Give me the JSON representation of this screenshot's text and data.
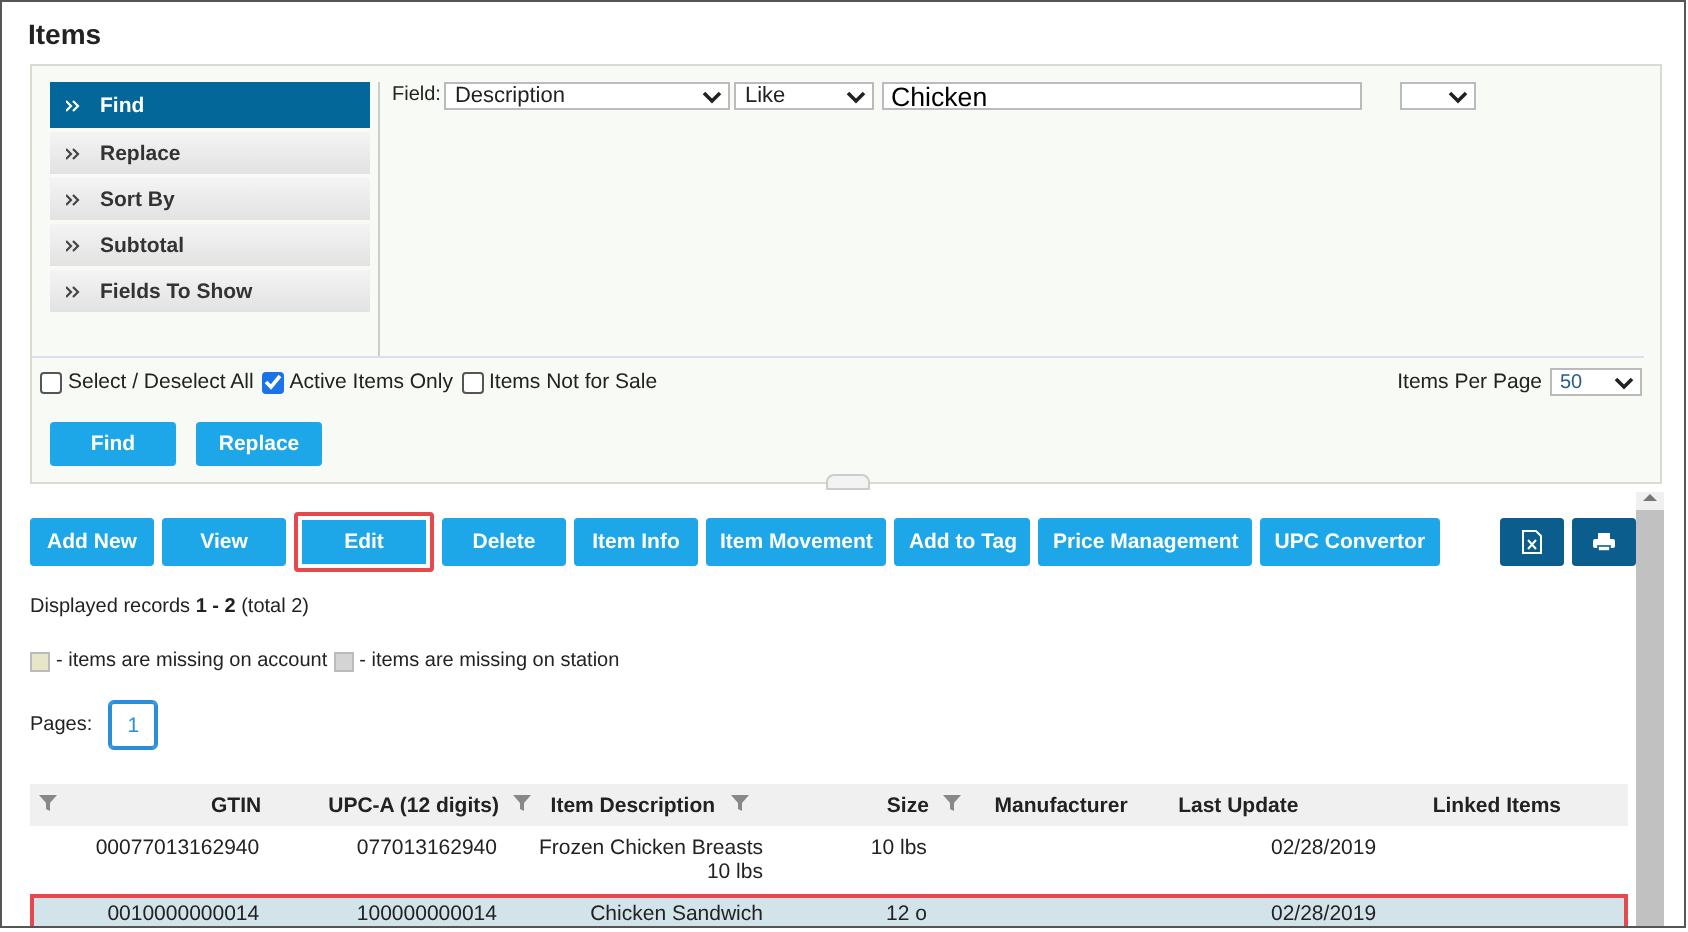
{
  "title": "Items",
  "search_panel": {
    "tabs": [
      {
        "label": "Find",
        "selected": true
      },
      {
        "label": "Replace",
        "selected": false
      },
      {
        "label": "Sort By",
        "selected": false
      },
      {
        "label": "Subtotal",
        "selected": false
      },
      {
        "label": "Fields To Show",
        "selected": false
      }
    ],
    "field_label": "Field:",
    "field": "Description",
    "operator": "Like",
    "value": "Chicken",
    "options": [
      {
        "label": "Select / Deselect All",
        "checked": false
      },
      {
        "label": "Active Items Only",
        "checked": true
      },
      {
        "label": "Items Not for Sale",
        "checked": false
      }
    ],
    "per_page_label": "Items Per Page",
    "per_page": "50",
    "buttons": [
      "Find",
      "Replace"
    ]
  },
  "actions": [
    {
      "label": "Add New",
      "highlighted": false
    },
    {
      "label": "View",
      "highlighted": false
    },
    {
      "label": "Edit",
      "highlighted": true
    },
    {
      "label": "Delete",
      "highlighted": false
    },
    {
      "label": "Item Info",
      "highlighted": false
    },
    {
      "label": "Item Movement",
      "highlighted": false
    },
    {
      "label": "Add to Tag",
      "highlighted": false
    },
    {
      "label": "Price Management",
      "highlighted": false
    },
    {
      "label": "UPC Convertor",
      "highlighted": false
    }
  ],
  "records": "Displayed records **1 - 2** (total 2)",
  "legend": [
    {
      "label": "- items are missing on account",
      "color": "#e8e6c8"
    },
    {
      "label": "- items are missing on station",
      "color": "#d4d4d4"
    }
  ],
  "pages_label": "Pages:",
  "pages": [
    {
      "label": "1",
      "selected": true
    }
  ],
  "table": {
    "columns": [
      {
        "label": "GTIN",
        "filter": true
      },
      {
        "label": "UPC-A (12 digits)",
        "filter": false
      },
      {
        "label": "Item Description",
        "filter": true
      },
      {
        "label": "Size",
        "filter": true
      },
      {
        "label": "Manufacturer",
        "filter": true
      },
      {
        "label": "Last Update",
        "filter": false
      },
      {
        "label": "Linked Items",
        "filter": false
      }
    ],
    "rows": [
      {
        "cells": [
          "00077013162940",
          "077013162940",
          "Frozen Chicken Breasts 10 lbs",
          "10 lbs",
          "",
          "02/28/2019",
          ""
        ],
        "selected": false,
        "highlighted": false
      },
      {
        "cells": [
          "0010000000014",
          "100000000014",
          "Chicken Sandwich",
          "12 o",
          "",
          "02/28/2019",
          ""
        ],
        "selected": true,
        "highlighted": true
      }
    ]
  }
}
